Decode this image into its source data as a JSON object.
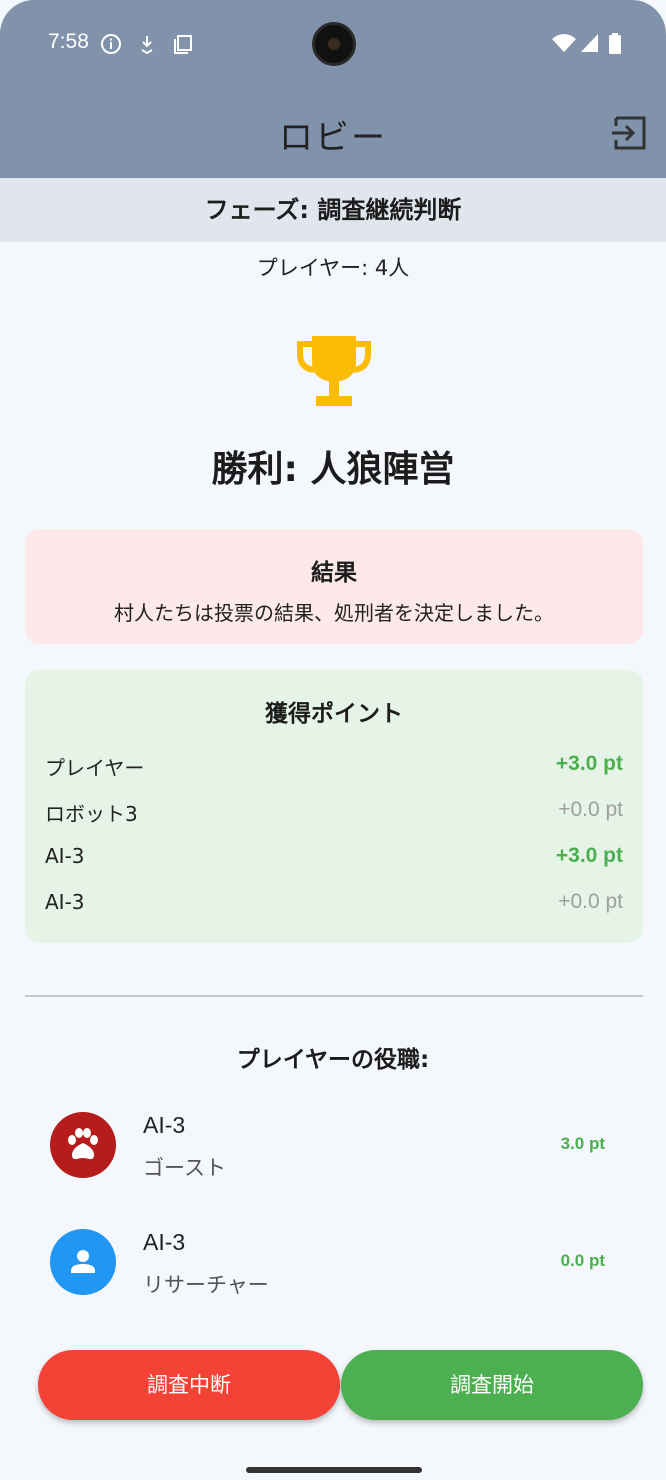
{
  "status_bar": {
    "time": "7:58"
  },
  "app_bar": {
    "title": "ロビー",
    "exit_icon": "exit-icon"
  },
  "phase": "フェーズ: 調査継続判断",
  "players_count": "プレイヤー: 4人",
  "winner": "勝利: 人狼陣営",
  "result": {
    "title": "結果",
    "text": "村人たちは投票の結果、処刑者を決定しました。"
  },
  "points": {
    "title": "獲得ポイント",
    "rows": [
      {
        "name": "プレイヤー",
        "value": "+3.0 pt"
      },
      {
        "name": "ロボット3",
        "value": "+0.0 pt"
      },
      {
        "name": "AI-3",
        "value": "+3.0 pt"
      },
      {
        "name": "AI-3",
        "value": "+0.0 pt"
      }
    ]
  },
  "roles": {
    "title": "プレイヤーの役職:",
    "items": [
      {
        "name": "AI-3",
        "role": "ゴースト",
        "points": "3.0 pt",
        "icon": "paw-icon",
        "color": "#b71c1c"
      },
      {
        "name": "AI-3",
        "role": "リサーチャー",
        "points": "0.0 pt",
        "icon": "person-icon",
        "color": "#2196f3"
      }
    ]
  },
  "buttons": {
    "stop": "調査中断",
    "start": "調査開始"
  },
  "colors": {
    "positive": "#4caf50",
    "zero": "#9e9e9e",
    "stop": "#f44336",
    "start": "#4caf50",
    "trophy": "#fbbc05"
  }
}
